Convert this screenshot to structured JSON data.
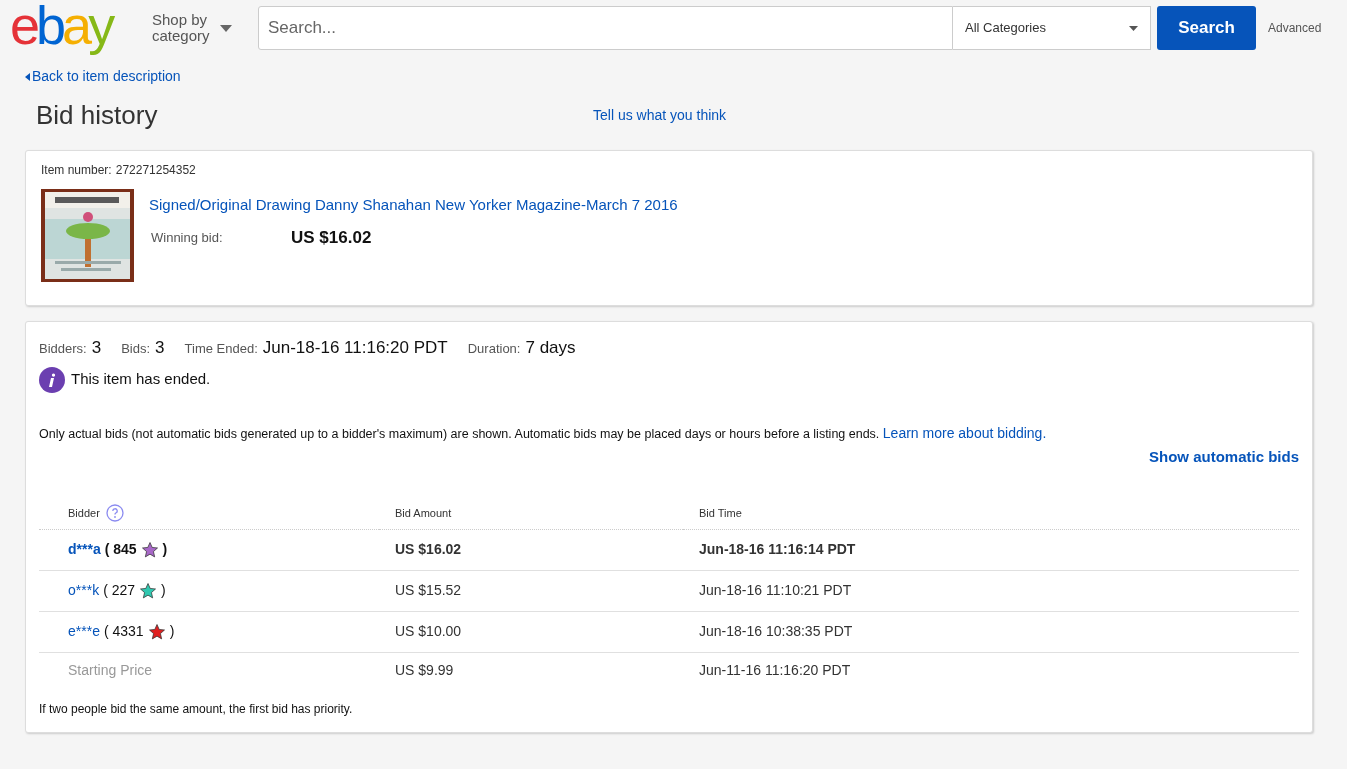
{
  "header": {
    "logo": [
      {
        "letter": "e",
        "color": "#e53238"
      },
      {
        "letter": "b",
        "color": "#0064d2"
      },
      {
        "letter": "a",
        "color": "#f5af02"
      },
      {
        "letter": "y",
        "color": "#86b817"
      }
    ],
    "shop_by": "Shop by category",
    "search_placeholder": "Search...",
    "category": "All Categories",
    "search_button": "Search",
    "advanced": "Advanced"
  },
  "back_link": "Back to item description",
  "title": "Bid history",
  "feedback_link": "Tell us what you think",
  "item": {
    "number_label": "Item number:",
    "number": "272271254352",
    "name": "Signed/Original Drawing Danny Shanahan New Yorker Magazine-March 7 2016",
    "winning_label": "Winning bid:",
    "winning_bid": "US $16.02"
  },
  "summary": [
    {
      "label": "Bidders:",
      "value": "3"
    },
    {
      "label": "Bids:",
      "value": "3"
    },
    {
      "label": "Time Ended:",
      "value": "Jun-18-16 11:16:20 PDT"
    },
    {
      "label": "Duration:",
      "value": "7 days"
    }
  ],
  "notice": "This item has ended.",
  "explanation": "Only actual bids (not automatic bids generated up to a bidder's maximum) are shown. Automatic bids may be placed days or hours before a listing ends.",
  "learn_more": "Learn more about bidding.",
  "show_automatic": "Show automatic bids",
  "table": {
    "columns": [
      "Bidder",
      "Bid Amount",
      "Bid Time"
    ],
    "rows": [
      {
        "kind": "bid",
        "bidder": "d***a",
        "score": "( 845",
        "score_close": ")",
        "color": "#a868c8",
        "amount": "US $16.02",
        "time": "Jun-18-16 11:16:14 PDT",
        "winning": true
      },
      {
        "kind": "bid",
        "bidder": "o***k",
        "score": "( 227",
        "score_close": ")",
        "color": "#30c8b0",
        "amount": "US $15.52",
        "time": "Jun-18-16 11:10:21 PDT",
        "winning": false
      },
      {
        "kind": "bid",
        "bidder": "e***e",
        "score": "( 4331",
        "score_close": ")",
        "color": "#e02020",
        "amount": "US $10.00",
        "time": "Jun-18-16 10:38:35 PDT",
        "winning": false
      },
      {
        "kind": "start",
        "bidder": "Starting Price",
        "amount": "US $9.99",
        "time": "Jun-11-16 11:16:20 PDT",
        "winning": false
      }
    ]
  },
  "footnote": "If two people bid the same amount, the first bid has priority."
}
